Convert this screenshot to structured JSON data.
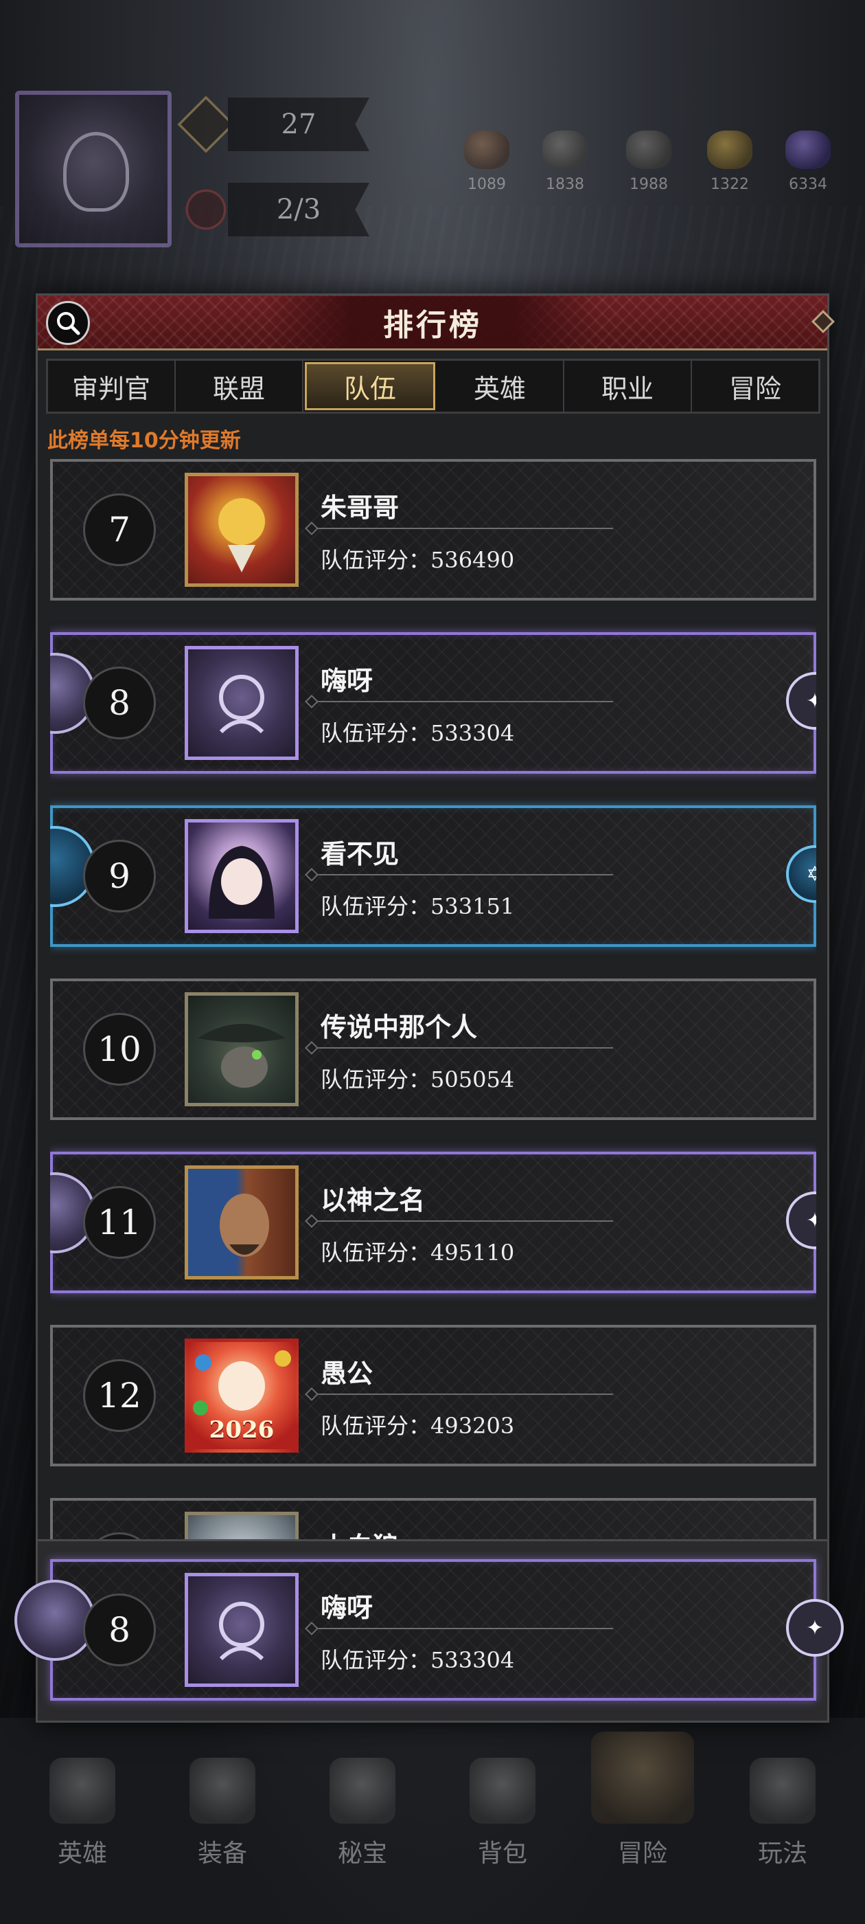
{
  "hud": {
    "level": "27",
    "count": "2/3",
    "resources": [
      "1089",
      "1838",
      "1988",
      "1322",
      "6334"
    ]
  },
  "modal": {
    "title": "排行榜",
    "tabs": [
      "审判官",
      "联盟",
      "队伍",
      "英雄",
      "职业",
      "冒险"
    ],
    "active_tab": "队伍",
    "notice": "此榜单每10分钟更新",
    "score_label": "队伍评分："
  },
  "entries": [
    {
      "rank": "7",
      "name": "朱哥哥",
      "score": "536490",
      "frame": "normal",
      "avatar": "sun-crest"
    },
    {
      "rank": "8",
      "name": "嗨呀",
      "score": "533304",
      "frame": "purple",
      "avatar": "purple-emblem"
    },
    {
      "rank": "9",
      "name": "看不见",
      "score": "533151",
      "frame": "blue",
      "avatar": "anime-girl"
    },
    {
      "rank": "10",
      "name": "传说中那个人",
      "score": "505054",
      "frame": "normal",
      "avatar": "hat-man"
    },
    {
      "rank": "11",
      "name": "以神之名",
      "score": "495110",
      "frame": "purple",
      "avatar": "split-face"
    },
    {
      "rank": "12",
      "name": "愚公",
      "score": "493203",
      "frame": "normal",
      "avatar": "2026-badge",
      "avatar_text": "2026"
    },
    {
      "rank": "",
      "name": "小白狼",
      "score": "",
      "frame": "normal",
      "avatar": "white-wolf"
    }
  ],
  "my_rank": {
    "rank": "8",
    "name": "嗨呀",
    "score": "533304",
    "frame": "purple"
  },
  "bottom_nav": [
    "英雄",
    "装备",
    "秘宝",
    "背包",
    "冒险",
    "玩法"
  ],
  "colors": {
    "header_red": "#6d1f22",
    "notice_orange": "#e07a2b",
    "tab_gold": "#c9a55a",
    "purple_frame": "#9178d6",
    "blue_frame": "#3f97c8"
  }
}
